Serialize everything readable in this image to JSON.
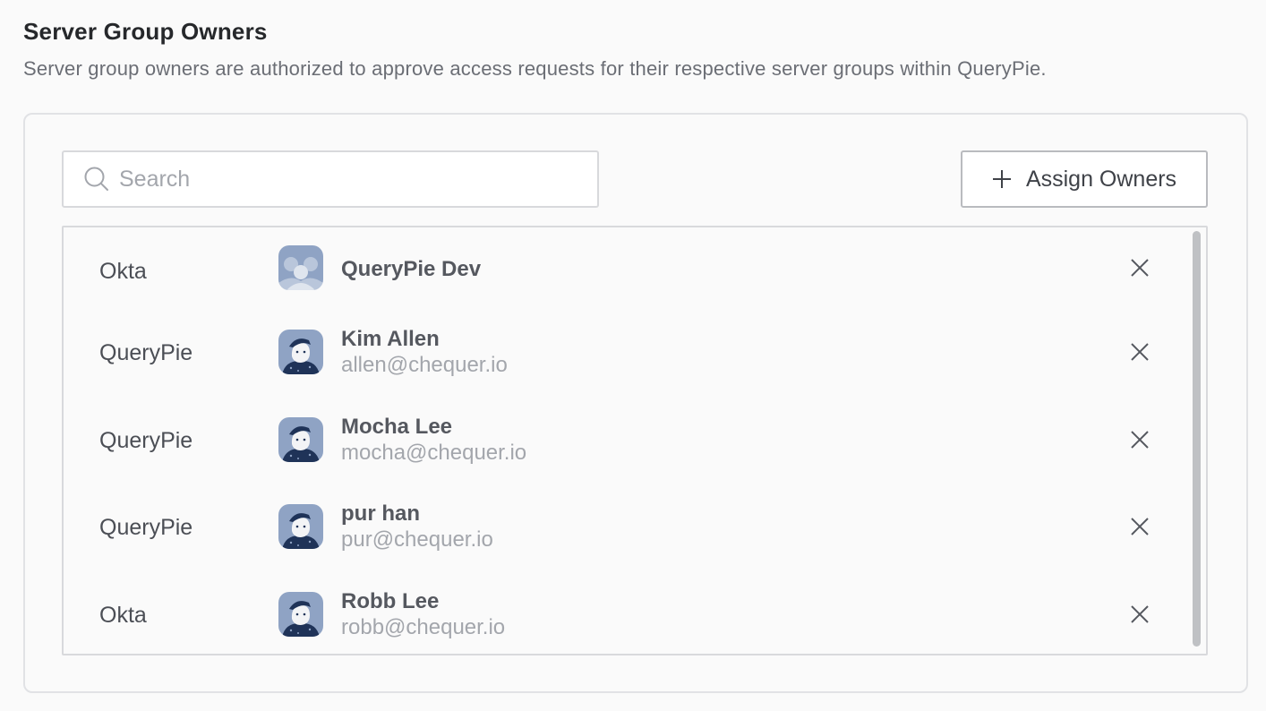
{
  "section": {
    "title": "Server Group Owners",
    "description": "Server group owners are authorized to approve access requests for their respective server groups within QueryPie."
  },
  "search": {
    "placeholder": "Search",
    "value": "",
    "icon": "search-icon"
  },
  "assign_button": {
    "label": "Assign Owners",
    "icon": "plus-icon"
  },
  "owners": [
    {
      "provider": "Okta",
      "name": "QueryPie Dev",
      "email": "",
      "avatar": "group-avatar-icon"
    },
    {
      "provider": "QueryPie",
      "name": "Kim Allen",
      "email": "allen@chequer.io",
      "avatar": "user-avatar-icon"
    },
    {
      "provider": "QueryPie",
      "name": "Mocha Lee",
      "email": "mocha@chequer.io",
      "avatar": "user-avatar-icon"
    },
    {
      "provider": "QueryPie",
      "name": "pur han",
      "email": "pur@chequer.io",
      "avatar": "user-avatar-icon"
    },
    {
      "provider": "Okta",
      "name": "Robb Lee",
      "email": "robb@chequer.io",
      "avatar": "user-avatar-icon"
    }
  ],
  "colors": {
    "avatar_bg": "#8fa3c4",
    "avatar_figure": "#1f3358",
    "text_primary": "#55585f",
    "text_secondary": "#a3a6ac"
  }
}
